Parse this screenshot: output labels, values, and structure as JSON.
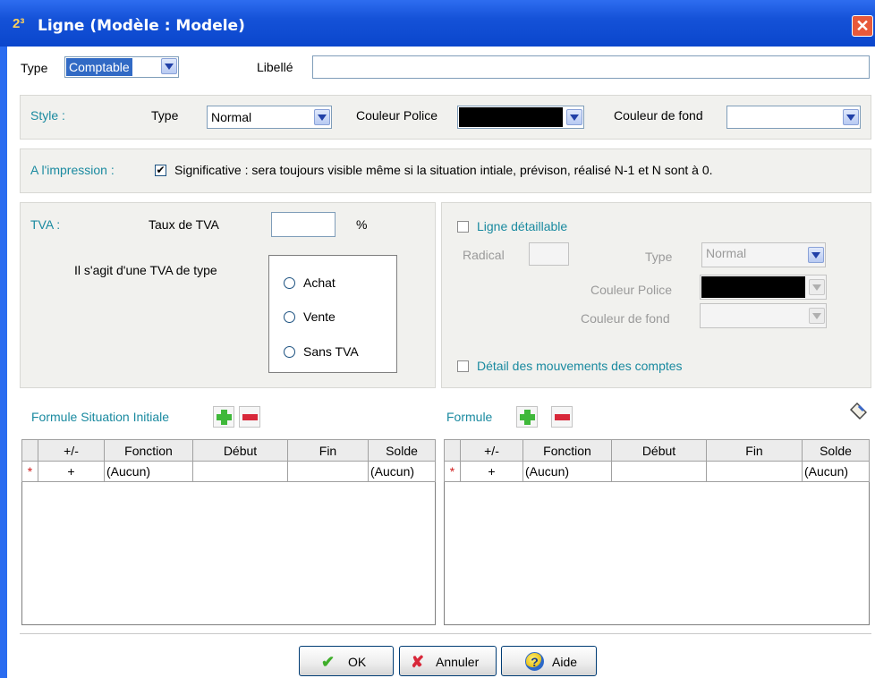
{
  "window": {
    "title": "Ligne (Modèle : Modele)",
    "app_icon": "2³",
    "close_glyph": "✕"
  },
  "header": {
    "type_label": "Type",
    "type_value": "Comptable",
    "libelle_label": "Libellé",
    "libelle_value": ""
  },
  "style": {
    "section_label": "Style :",
    "type_label": "Type",
    "type_value": "Normal",
    "couleur_police_label": "Couleur Police",
    "couleur_police_value": "#000000",
    "couleur_fond_label": "Couleur de fond",
    "couleur_fond_value": "#ffffff"
  },
  "impression": {
    "section_label": "A l'impression :",
    "checkbox_glyph": "✔",
    "significative_checked": true,
    "significative_label": "Significative : sera toujours visible même si la situation intiale, prévison, réalisé N-1 et N sont à 0."
  },
  "tva": {
    "section_label": "TVA :",
    "taux_label": "Taux de TVA",
    "taux_value": "",
    "percent": "%",
    "type_question": "Il s'agit d'une TVA de type",
    "options": [
      "Achat",
      "Vente",
      "Sans TVA"
    ]
  },
  "detail": {
    "ligne_detaillable_label": "Ligne détaillable",
    "ligne_detaillable_checked": false,
    "radical_label": "Radical",
    "radical_value": "",
    "type_label": "Type",
    "type_value": "Normal",
    "couleur_police_label": "Couleur Police",
    "couleur_police_value": "#000000",
    "couleur_fond_label": "Couleur de fond",
    "mouvements_label": "Détail des mouvements des comptes",
    "mouvements_checked": false
  },
  "formule_initiale": {
    "label": "Formule Situation Initiale",
    "columns": [
      "",
      "+/-",
      "Fonction",
      "Début",
      "Fin",
      "Solde"
    ],
    "rows": [
      {
        "marker": "*",
        "sign": "+",
        "fonction": "(Aucun)",
        "debut": "",
        "fin": "",
        "solde": "(Aucun)"
      }
    ]
  },
  "formule": {
    "label": "Formule",
    "columns": [
      "",
      "+/-",
      "Fonction",
      "Début",
      "Fin",
      "Solde"
    ],
    "rows": [
      {
        "marker": "*",
        "sign": "+",
        "fonction": "(Aucun)",
        "debut": "",
        "fin": "",
        "solde": "(Aucun)"
      }
    ]
  },
  "footer": {
    "ok_label": "OK",
    "ok_glyph": "✔",
    "annuler_label": "Annuler",
    "annuler_glyph": "✘",
    "aide_label": "Aide",
    "aide_glyph": "?"
  },
  "colors": {
    "title_bar": "#1552d8",
    "accent_text": "#1a8aa0",
    "add": "#3fb83a",
    "remove": "#d8283a"
  },
  "icons": [
    "app-icon",
    "close-icon",
    "dropdown-arrow-icon",
    "check-icon",
    "plus-icon",
    "minus-icon",
    "eraser-icon",
    "ok-check-icon",
    "cancel-x-icon",
    "help-icon"
  ]
}
